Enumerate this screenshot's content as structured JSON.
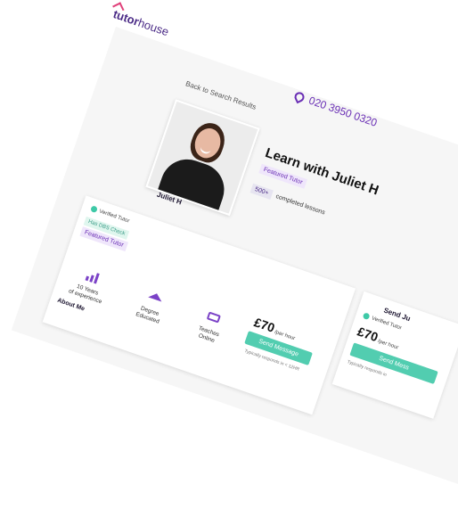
{
  "brand": {
    "part1": "tutor",
    "part2": "house"
  },
  "header": {
    "phone": "020 3950 0320"
  },
  "nav": {
    "back_label": "Back to Search Results"
  },
  "profile": {
    "name": "Juliet H",
    "title": "Learn with Juliet H",
    "featured_label": "Featured Tutor",
    "lessons_count": "500+",
    "lessons_label": "completed lessons"
  },
  "card": {
    "verified_label": "Verified Tutor",
    "dbs_label": "Has DBS Check",
    "featured_label": "Featured Tutor",
    "features": [
      {
        "icon": "bar-chart-icon",
        "line1": "10 Years",
        "line2": "of experience"
      },
      {
        "icon": "graduation-cap-icon",
        "line1": "Degree",
        "line2": "Educated"
      },
      {
        "icon": "laptop-icon",
        "line1": "Teaches",
        "line2": "Online"
      }
    ],
    "about_label": "About Me",
    "price": "£70",
    "price_unit": "/per hour",
    "send_label": "Send Message",
    "responds_text": "Typically responds in < 12HR"
  },
  "sidebar": {
    "send_title": "Send Ju",
    "verified_label": "Verified Tutor",
    "price": "£70",
    "price_unit": "/per hour",
    "send_label": "Send Mess",
    "responds_text": "Typically responds in"
  },
  "colors": {
    "accent": "#6a2fb5",
    "button": "#52cdb0",
    "brand_pink": "#e0407a"
  }
}
